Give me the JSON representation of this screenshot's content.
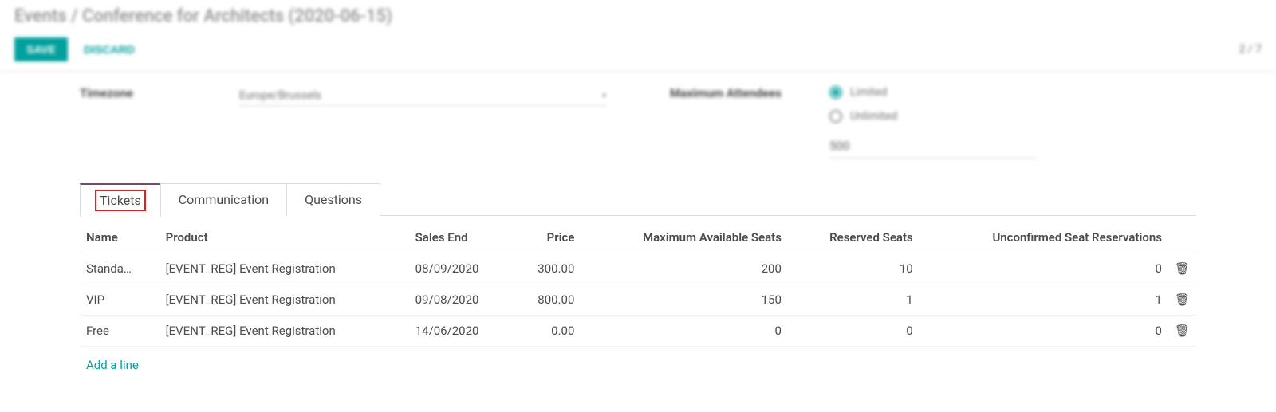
{
  "header": {
    "breadcrumb_root": "Events",
    "breadcrumb_sep": " / ",
    "breadcrumb_title": "Conference for Architects (2020-06-15)",
    "save_label": "SAVE",
    "discard_label": "DISCARD",
    "pager": "2 / 7"
  },
  "form": {
    "timezone_label": "Timezone",
    "timezone_value": "Europe/Brussels",
    "max_attendees_label": "Maximum Attendees",
    "limited_label": "Limited",
    "unlimited_label": "Unlimited",
    "max_attendees_value": "500"
  },
  "tabs": {
    "tickets": "Tickets",
    "communication": "Communication",
    "questions": "Questions"
  },
  "table": {
    "headers": {
      "name": "Name",
      "product": "Product",
      "sales_end": "Sales End",
      "price": "Price",
      "max_seats": "Maximum Available Seats",
      "reserved": "Reserved Seats",
      "unconfirmed": "Unconfirmed Seat Reservations"
    },
    "rows": [
      {
        "name": "Standa…",
        "product": "[EVENT_REG] Event Registration",
        "sales_end": "08/09/2020",
        "price": "300.00",
        "max_seats": "200",
        "reserved": "10",
        "unconfirmed": "0"
      },
      {
        "name": "VIP",
        "product": "[EVENT_REG] Event Registration",
        "sales_end": "09/08/2020",
        "price": "800.00",
        "max_seats": "150",
        "reserved": "1",
        "unconfirmed": "1"
      },
      {
        "name": "Free",
        "product": "[EVENT_REG] Event Registration",
        "sales_end": "14/06/2020",
        "price": "0.00",
        "max_seats": "0",
        "reserved": "0",
        "unconfirmed": "0"
      }
    ],
    "add_line": "Add a line"
  },
  "icons": {
    "trash": "🗑"
  }
}
